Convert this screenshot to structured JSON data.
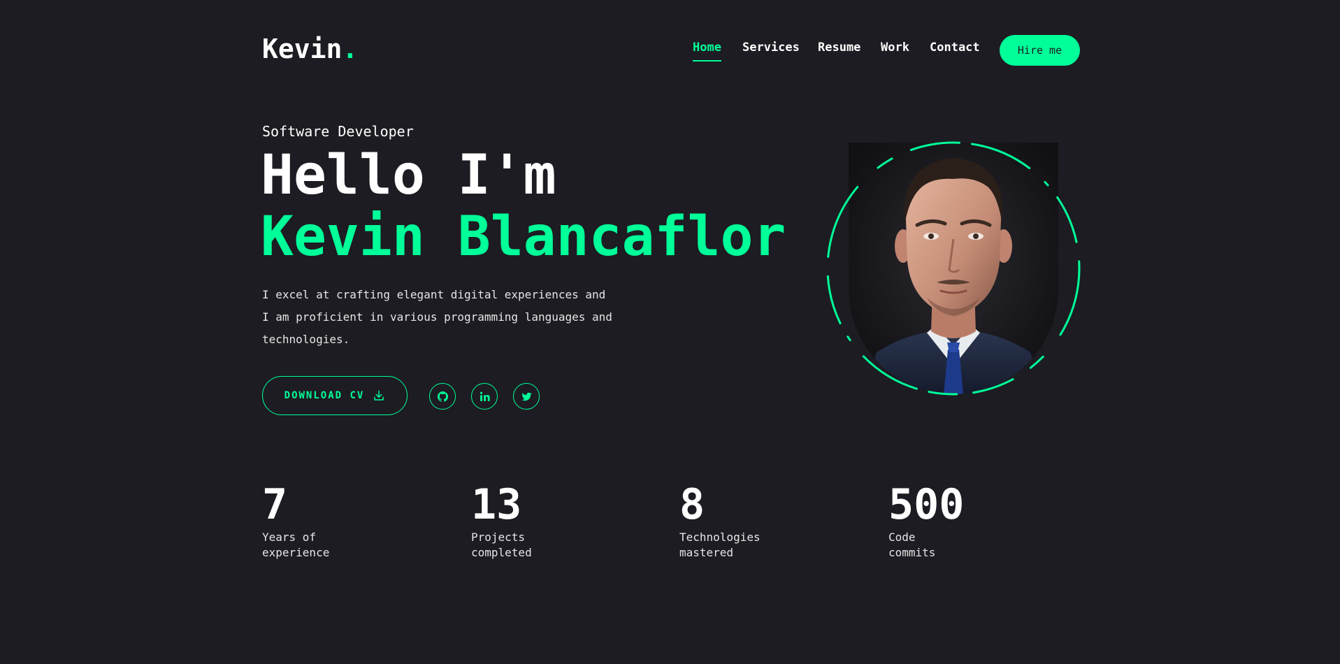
{
  "header": {
    "logo_text": "Kevin",
    "logo_dot": ".",
    "nav": [
      {
        "label": "Home",
        "active": true
      },
      {
        "label": "Services",
        "active": false
      },
      {
        "label": "Resume",
        "active": false
      },
      {
        "label": "Work",
        "active": false
      },
      {
        "label": "Contact",
        "active": false
      }
    ],
    "hire_label": "Hire me"
  },
  "hero": {
    "role": "Software Developer",
    "greeting": "Hello I'm",
    "name": "Kevin Blancaflor",
    "bio_lines": [
      "I excel at crafting elegant digital experiences and",
      "I am proficient in various programming languages and",
      "technologies."
    ],
    "cv_label": "DOWNLOAD CV",
    "socials": [
      "github-icon",
      "linkedin-icon",
      "twitter-icon"
    ]
  },
  "stats": [
    {
      "value": "7",
      "label_lines": [
        "Years of",
        "experience"
      ]
    },
    {
      "value": "13",
      "label_lines": [
        "Projects",
        "completed"
      ]
    },
    {
      "value": "8",
      "label_lines": [
        "Technologies",
        "mastered"
      ]
    },
    {
      "value": "500",
      "label_lines": [
        "Code",
        "commits"
      ]
    }
  ],
  "colors": {
    "background": "#1c1c22",
    "accent": "#00ff99",
    "text": "#ffffff"
  }
}
